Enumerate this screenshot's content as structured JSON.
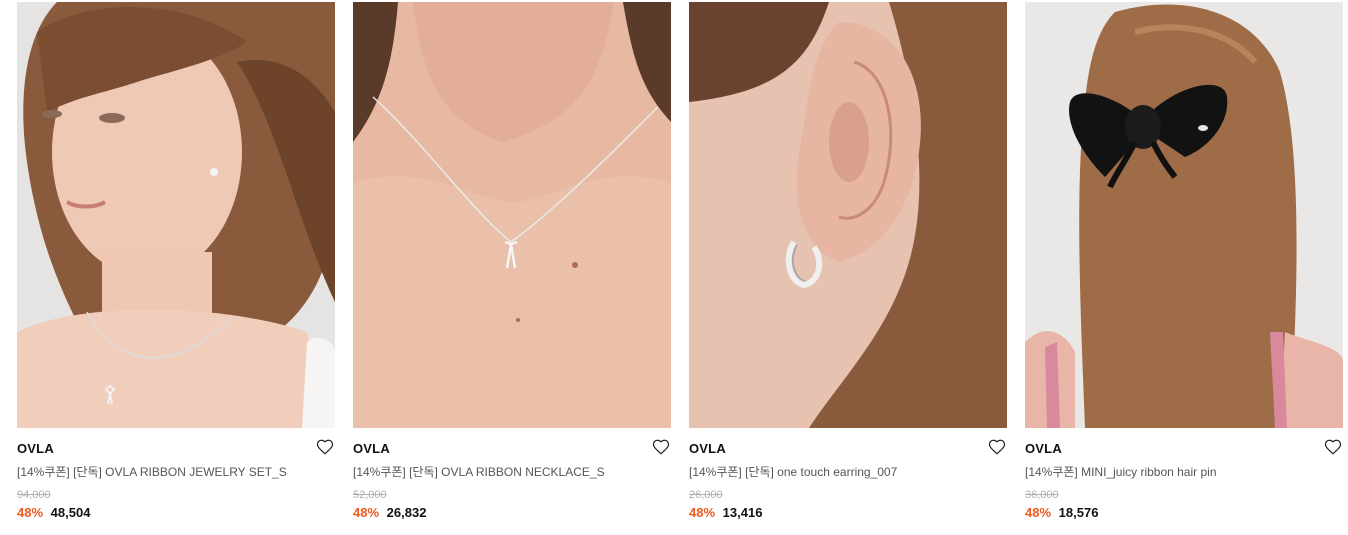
{
  "colors": {
    "discount": "#f0591a",
    "text": "#111111",
    "muted": "#555555",
    "strike": "#b0b0b0"
  },
  "products": [
    {
      "brand": "OVLA",
      "title": "[14%쿠폰] [단독] OVLA RIBBON JEWELRY SET_S",
      "original_price": "94,000",
      "discount": "48%",
      "sale_price": "48,504",
      "image": "model-with-ribbon-necklace-and-earring",
      "wishlist_icon": "heart-outline-icon"
    },
    {
      "brand": "OVLA",
      "title": "[14%쿠폰] [단독] OVLA RIBBON NECKLACE_S",
      "original_price": "52,000",
      "discount": "48%",
      "sale_price": "26,832",
      "image": "neck-with-ribbon-pendant",
      "wishlist_icon": "heart-outline-icon"
    },
    {
      "brand": "OVLA",
      "title": "[14%쿠폰] [단독] one touch earring_007",
      "original_price": "26,000",
      "discount": "48%",
      "sale_price": "13,416",
      "image": "ear-with-silver-hoop",
      "wishlist_icon": "heart-outline-icon"
    },
    {
      "brand": "OVLA",
      "title": "[14%쿠폰] MINI_juicy ribbon hair pin",
      "original_price": "36,000",
      "discount": "48%",
      "sale_price": "18,576",
      "image": "hair-with-black-bow",
      "wishlist_icon": "heart-outline-icon"
    }
  ]
}
